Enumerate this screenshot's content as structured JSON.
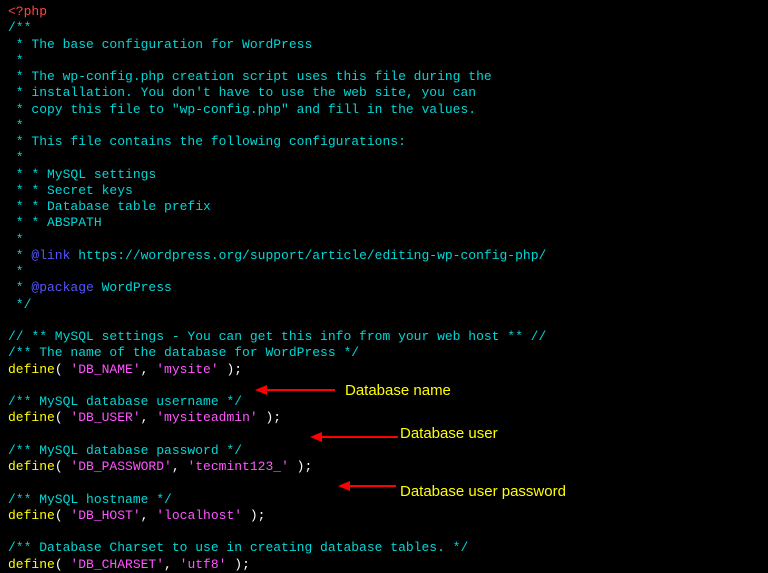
{
  "code": {
    "php_open": "<?php",
    "comment_start": "/**",
    "c1": " * The base configuration for WordPress",
    "c2": " *",
    "c3": " * The wp-config.php creation script uses this file during the",
    "c4": " * installation. You don't have to use the web site, you can",
    "c5": " * copy this file to \"wp-config.php\" and fill in the values.",
    "c6": " *",
    "c7": " * This file contains the following configurations:",
    "c8": " *",
    "c9": " * * MySQL settings",
    "c10": " * * Secret keys",
    "c11": " * * Database table prefix",
    "c12": " * * ABSPATH",
    "c13": " *",
    "link_prefix": " * ",
    "link_tag": "@link",
    "link_url": " https://wordpress.org/support/article/editing-wp-config-php/",
    "c14": " *",
    "pkg_prefix": " * ",
    "pkg_tag": "@package",
    "pkg_name": " WordPress",
    "comment_end": " */",
    "mysql_comment": "// ** MySQL settings - You can get this info from your web host ** //",
    "db_name_comment": "/** The name of the database for WordPress */",
    "db_user_comment": "/** MySQL database username */",
    "db_pass_comment": "/** MySQL database password */",
    "db_host_comment": "/** MySQL hostname */",
    "db_charset_comment": "/** Database Charset to use in creating database tables. */",
    "define": "define",
    "paren_open": "( ",
    "comma": ", ",
    "paren_close": " );",
    "db_name_key": "'DB_NAME'",
    "db_name_val": "'mysite'",
    "db_user_key": "'DB_USER'",
    "db_user_val": "'mysiteadmin'",
    "db_pass_key": "'DB_PASSWORD'",
    "db_pass_val": "'tecmint123_'",
    "db_host_key": "'DB_HOST'",
    "db_host_val": "'localhost'",
    "db_charset_key": "'DB_CHARSET'",
    "db_charset_val": "'utf8'"
  },
  "annotations": {
    "db_name": "Database name",
    "db_user": "Database user",
    "db_pass": "Database user password"
  }
}
